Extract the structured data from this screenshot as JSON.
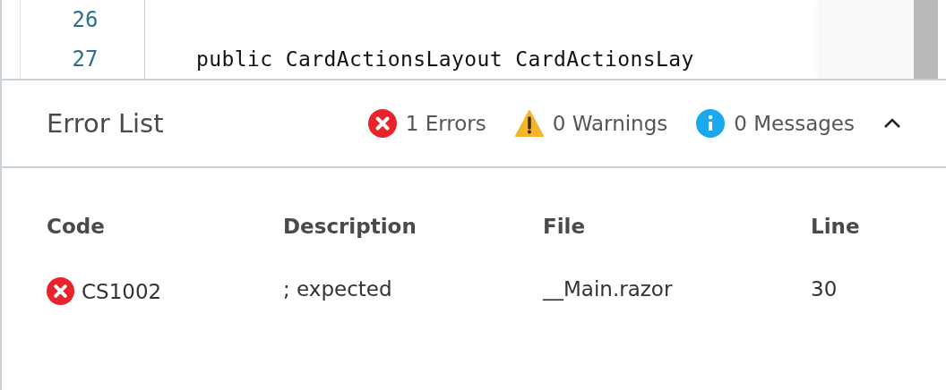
{
  "editor": {
    "lines": [
      {
        "number": "26"
      },
      {
        "number": "27",
        "code": "    public CardActionsLayout CardActionsLay"
      }
    ]
  },
  "error_list": {
    "title": "Error List",
    "expanded": true,
    "counts": [
      {
        "kind": "error",
        "label": "1 Errors"
      },
      {
        "kind": "warning",
        "label": "0 Warnings"
      },
      {
        "kind": "info",
        "label": "0 Messages"
      }
    ],
    "columns": [
      "Code",
      "Description",
      "File",
      "Line"
    ],
    "rows": [
      {
        "kind": "error",
        "cells": [
          "CS1002",
          "; expected",
          "__Main.razor",
          "30"
        ]
      }
    ]
  }
}
